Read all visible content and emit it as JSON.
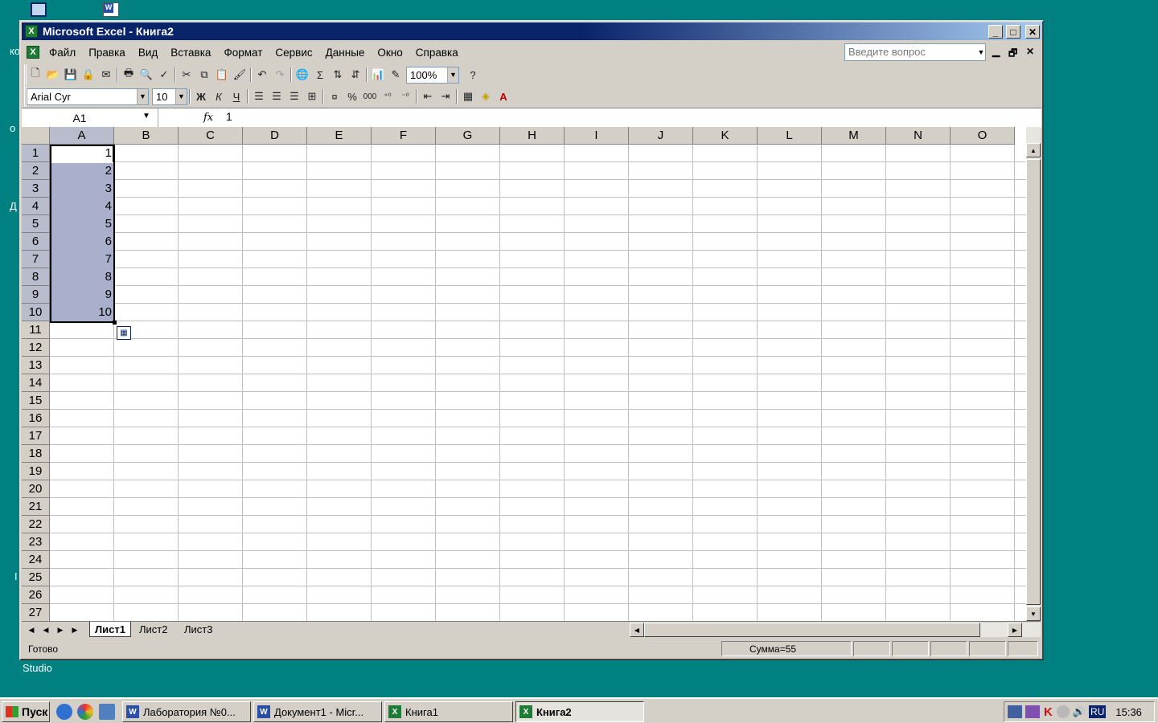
{
  "desktop": {
    "fragments": [
      "ко",
      "о",
      "Д",
      "I",
      "Studio"
    ]
  },
  "window": {
    "title": "Microsoft Excel - Книга2",
    "min_glyph": "_",
    "max_glyph": "□",
    "close_glyph": "✕"
  },
  "menu": {
    "items": [
      "Файл",
      "Правка",
      "Вид",
      "Вставка",
      "Формат",
      "Сервис",
      "Данные",
      "Окно",
      "Справка"
    ],
    "ask_placeholder": "Введите вопрос",
    "doc_min": "▁",
    "doc_restore": "🗗",
    "doc_close": "✕"
  },
  "toolbar": {
    "zoom": "100%",
    "font": "Arial Cyr",
    "size": "10",
    "bold": "Ж",
    "italic": "К",
    "underline": "Ч",
    "percent": "%",
    "thousands": "000",
    "sigma": "Σ"
  },
  "formula": {
    "cell": "A1",
    "fx": "fx",
    "value": "1"
  },
  "columns": [
    "A",
    "B",
    "C",
    "D",
    "E",
    "F",
    "G",
    "H",
    "I",
    "J",
    "K",
    "L",
    "M",
    "N",
    "O"
  ],
  "rows": [
    "1",
    "2",
    "3",
    "4",
    "5",
    "6",
    "7",
    "8",
    "9",
    "10",
    "11",
    "12",
    "13",
    "14",
    "15",
    "16",
    "17",
    "18",
    "19",
    "20",
    "21",
    "22",
    "23",
    "24",
    "25",
    "26",
    "27"
  ],
  "cells_A": [
    "1",
    "2",
    "3",
    "4",
    "5",
    "6",
    "7",
    "8",
    "9",
    "10"
  ],
  "sheets": [
    "Лист1",
    "Лист2",
    "Лист3"
  ],
  "status": {
    "ready": "Готово",
    "sum": "Сумма=55"
  },
  "taskbar": {
    "start": "Пуск",
    "tasks": [
      "Лаборатория №0...",
      "Документ1 - Micr...",
      "Книга1",
      "Книга2"
    ],
    "lang": "RU",
    "clock": "15:36"
  },
  "colors": {
    "title_blue": "#0a246a",
    "desktop": "#008080",
    "selection": "#aab0cc",
    "excel_green": "#1e7b34"
  }
}
